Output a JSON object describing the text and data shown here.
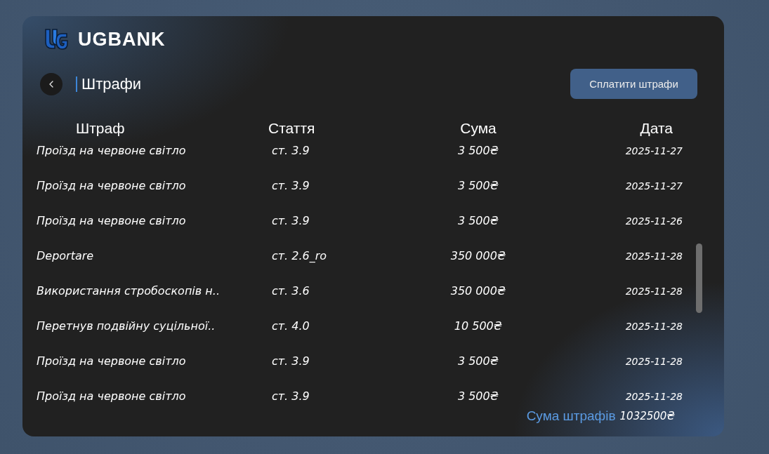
{
  "app": {
    "brand": "UGBANK"
  },
  "page": {
    "title": "Штрафи",
    "action_button": "Сплатити штрафи"
  },
  "table": {
    "columns": [
      "Штраф",
      "Стаття",
      "Сума",
      "Дата"
    ],
    "rows": [
      [
        "Проїзд на червоне світло",
        "ст. 3.9",
        "3 500₴",
        "2025-11-27"
      ],
      [
        "Проїзд на червоне світло",
        "ст. 3.9",
        "3 500₴",
        "2025-11-27"
      ],
      [
        "Проїзд на червоне світло",
        "ст. 3.9",
        "3 500₴",
        "2025-11-26"
      ],
      [
        "Deportare",
        "ст. 2.6_ro",
        "350 000₴",
        "2025-11-28"
      ],
      [
        "Використання стробоскопів н..",
        "ст. 3.6",
        "350 000₴",
        "2025-11-28"
      ],
      [
        "Перетнув подвійну суцільної..",
        "ст. 4.0",
        "10 500₴",
        "2025-11-28"
      ],
      [
        "Проїзд на червоне світло",
        "ст. 3.9",
        "3 500₴",
        "2025-11-28"
      ],
      [
        "Проїзд на червоне світло",
        "ст. 3.9",
        "3 500₴",
        "2025-11-28"
      ]
    ]
  },
  "total": {
    "label": "Сума штрафів",
    "value": "1032500₴"
  }
}
